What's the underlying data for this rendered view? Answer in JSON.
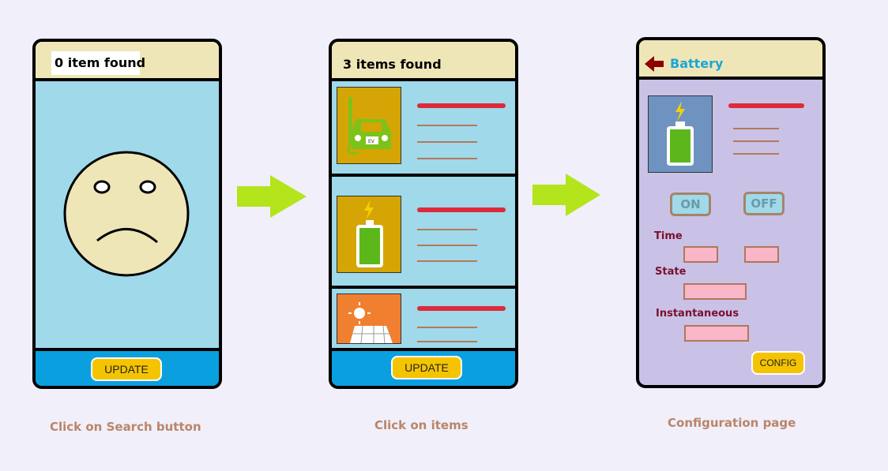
{
  "screen1": {
    "header_title": "0 item found",
    "update_label": "UPDATE",
    "caption": "Click on Search button"
  },
  "screen2": {
    "header_title": "3 items found",
    "update_label": "UPDATE",
    "caption": "Click on items",
    "items": [
      {
        "icon": "ev-car-icon",
        "thumb_color": "#d4a504",
        "badge": "EV"
      },
      {
        "icon": "battery-icon",
        "thumb_color": "#d4a504"
      },
      {
        "icon": "solar-panel-icon",
        "thumb_color": "#f08030"
      }
    ]
  },
  "screen3": {
    "header_title": "Battery",
    "on_label": "ON",
    "off_label": "OFF",
    "time_label": "Time",
    "state_label": "State",
    "instant_label": "Instantaneous",
    "config_label": "CONFIG",
    "caption": "Configuration page"
  },
  "colors": {
    "arrow": "#b4e41c",
    "list_bg": "#9fd9ea",
    "config_bg": "#c9c2e6",
    "footer_bg": "#0aa0e0",
    "accent_red": "#dd2a3a",
    "button_yellow": "#f5c400"
  }
}
